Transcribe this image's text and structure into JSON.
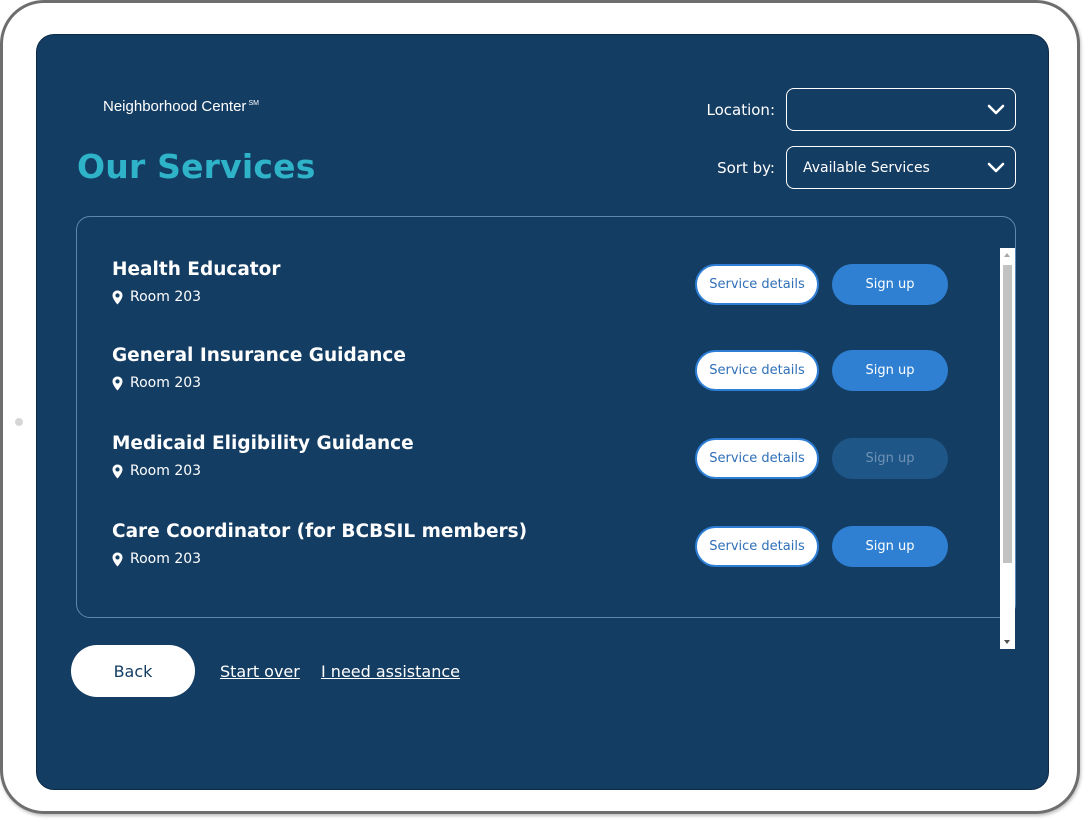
{
  "header": {
    "brand": "Neighborhood Center",
    "brand_mark": "SM",
    "title": "Our Services"
  },
  "filters": {
    "location_label": "Location:",
    "location_value": "",
    "sort_label": "Sort by:",
    "sort_value": "Available Services"
  },
  "services": [
    {
      "name": "Health Educator",
      "location": "Room 203",
      "details_label": "Service details",
      "signup_label": "Sign up",
      "signup_enabled": true
    },
    {
      "name": "General Insurance Guidance",
      "location": "Room 203",
      "details_label": "Service details",
      "signup_label": "Sign up",
      "signup_enabled": true
    },
    {
      "name": "Medicaid Eligibility Guidance",
      "location": "Room 203",
      "details_label": "Service details",
      "signup_label": "Sign up",
      "signup_enabled": false
    },
    {
      "name": "Care Coordinator (for BCBSIL members)",
      "location": "Room 203",
      "details_label": "Service details",
      "signup_label": "Sign up",
      "signup_enabled": true
    }
  ],
  "footer": {
    "back_label": "Back",
    "start_over_label": "Start over",
    "assistance_label": "I need assistance"
  },
  "colors": {
    "background": "#143d63",
    "title_accent": "#2fb3c9",
    "signup_button": "#2f80d3",
    "signup_disabled": "#1f5688"
  },
  "icons": {
    "dropdown": "chevron-down-icon",
    "location": "map-pin-icon"
  }
}
